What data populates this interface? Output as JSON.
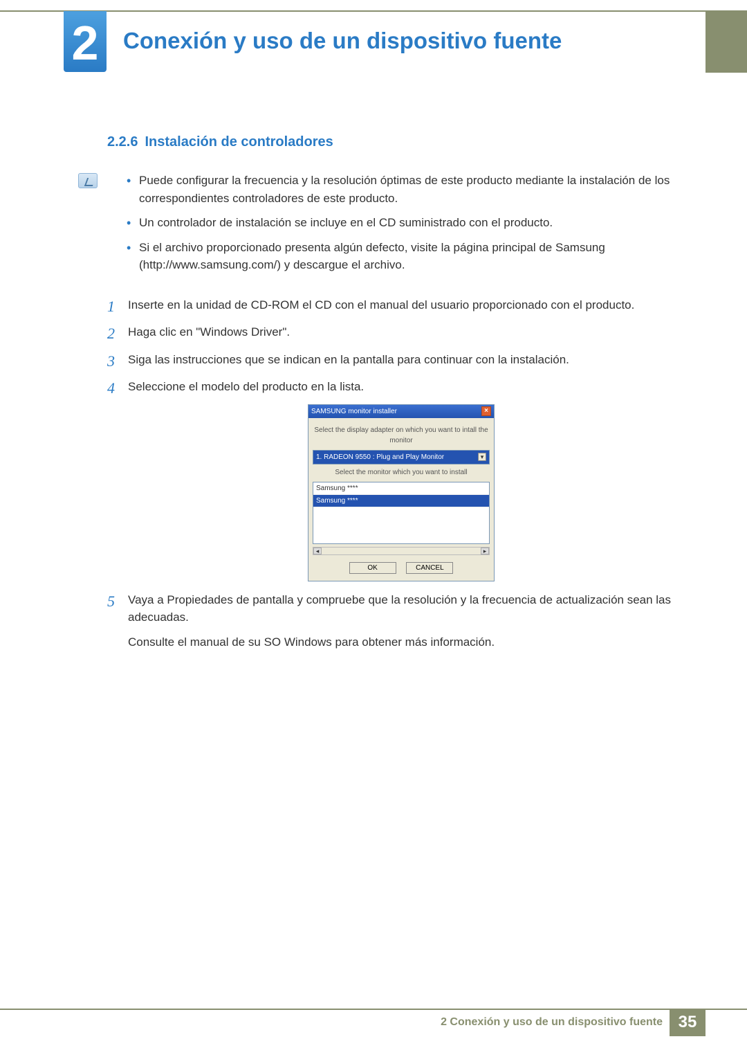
{
  "chapter": {
    "number": "2",
    "title": "Conexión y uso de un dispositivo fuente"
  },
  "section": {
    "number": "2.2.6",
    "title": "Instalación de controladores"
  },
  "notes": [
    "Puede configurar la frecuencia y la resolución óptimas de este producto mediante la instalación de los correspondientes controladores de este producto.",
    "Un controlador de instalación se incluye en el CD suministrado con el producto.",
    "Si el archivo proporcionado presenta algún defecto, visite la página principal de Samsung (http://www.samsung.com/) y descargue el archivo."
  ],
  "steps": {
    "s1": "Inserte en la unidad de CD-ROM el CD con el manual del usuario proporcionado con el producto.",
    "s2": "Haga clic en \"Windows Driver\".",
    "s3": "Siga las instrucciones que se indican en la pantalla para continuar con la instalación.",
    "s4": "Seleccione el modelo del producto en la lista.",
    "s5a": "Vaya a Propiedades de pantalla y compruebe que la resolución y la frecuencia de actualización sean las adecuadas.",
    "s5b": "Consulte el manual de su SO Windows para obtener más información."
  },
  "stepnums": {
    "n1": "1",
    "n2": "2",
    "n3": "3",
    "n4": "4",
    "n5": "5"
  },
  "installer": {
    "title": "SAMSUNG monitor installer",
    "label1": "Select the display adapter on which you want to intall the monitor",
    "adapter": "1. RADEON 9550 : Plug and Play Monitor",
    "label2": "Select the monitor which you want to install",
    "item1": "Samsung ****",
    "item2": "Samsung ****",
    "ok": "OK",
    "cancel": "CANCEL"
  },
  "footer": {
    "title": "2 Conexión y uso de un dispositivo fuente",
    "page": "35"
  }
}
